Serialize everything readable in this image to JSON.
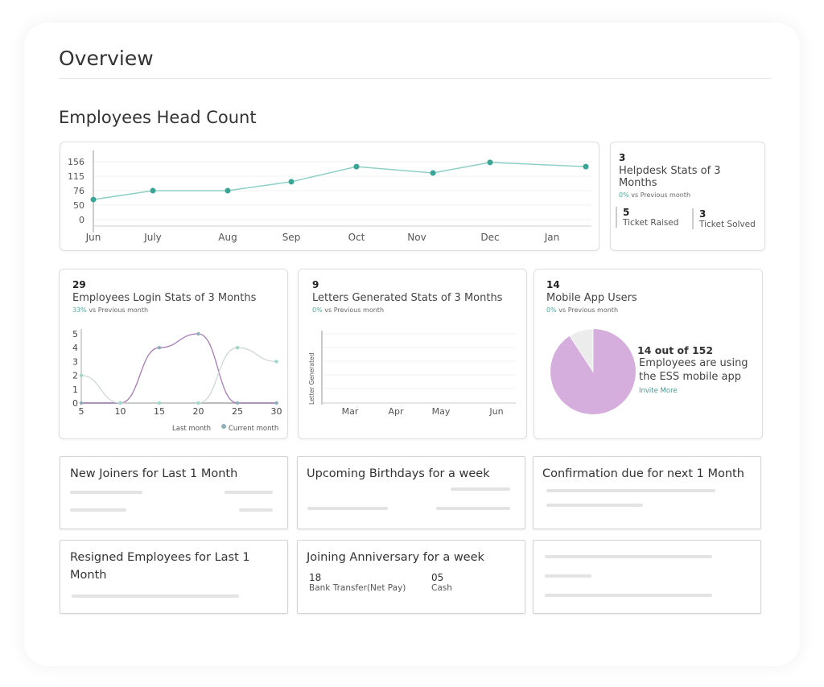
{
  "page": {
    "title": "Overview",
    "section_title": "Employees Head Count"
  },
  "colors": {
    "accent": "#3aa597",
    "line_light": "#8fd0c6",
    "purple": "#a77bb8",
    "pie_main": "#d5aedd",
    "pie_rest": "#ececec"
  },
  "helpdesk": {
    "count": "3",
    "title": "Helpdesk Stats of 3 Months",
    "pct": "0%",
    "vs": " vs Previous month",
    "raised_value": "5",
    "raised_label": "Ticket Raised",
    "solved_value": "3",
    "solved_label": "Ticket Solved"
  },
  "login": {
    "count": "29",
    "title": "Employees Login Stats of 3 Months",
    "pct": "33%",
    "vs": " vs Previous month"
  },
  "letters": {
    "count": "9",
    "title": "Letters Generated Stats of 3 Months",
    "pct": "0%",
    "vs": " vs Previous month"
  },
  "mobile": {
    "count": "14",
    "title": "Mobile App Users",
    "pct": "0%",
    "vs": " vs Previous month",
    "headline": "14 out of 152",
    "desc1": "Employees are using",
    "desc2": "the ESS mobile app",
    "invite": "Invite More"
  },
  "lists": {
    "new_joiners": "New Joiners for Last 1 Month",
    "birthdays": "Upcoming Birthdays for a week",
    "confirmation": "Confirmation due for next 1 Month",
    "resigned": "Resigned Employees for Last 1 Month",
    "anniversary": {
      "title": "Joining Anniversary for a week",
      "v1": "18",
      "l1": "Bank Transfer(Net Pay)",
      "v2": "05",
      "l2": "Cash"
    }
  },
  "chart_data": [
    {
      "type": "line",
      "categories": [
        "Jun",
        "July",
        "Aug",
        "Sep",
        "Oct",
        "Nov",
        "Dec",
        "Jan"
      ],
      "values": [
        60,
        76,
        76,
        100,
        142,
        124,
        154,
        142
      ],
      "yticks": [
        0,
        50,
        76,
        115,
        156
      ],
      "grid": true
    },
    {
      "type": "line",
      "x": [
        5,
        10,
        15,
        20,
        25,
        30
      ],
      "xticks": [
        5,
        10,
        15,
        20,
        25,
        30
      ],
      "yticks": [
        0,
        1,
        2,
        3,
        4,
        5
      ],
      "ylim": [
        0,
        5
      ],
      "series": [
        {
          "name": "Last month",
          "values": [
            0,
            0,
            4,
            5,
            0,
            0
          ],
          "color": "#a77bb8"
        },
        {
          "name": "Current month",
          "values": [
            2,
            0,
            0,
            0,
            4,
            3
          ],
          "color": "#cfd8d6"
        }
      ],
      "legend": "bottom-right"
    },
    {
      "type": "line",
      "categories": [
        "Mar",
        "Apr",
        "May",
        "Jun"
      ],
      "ylabel": "Letter Generated",
      "series": []
    },
    {
      "type": "pie",
      "values": [
        14,
        138
      ],
      "total": 152
    }
  ]
}
